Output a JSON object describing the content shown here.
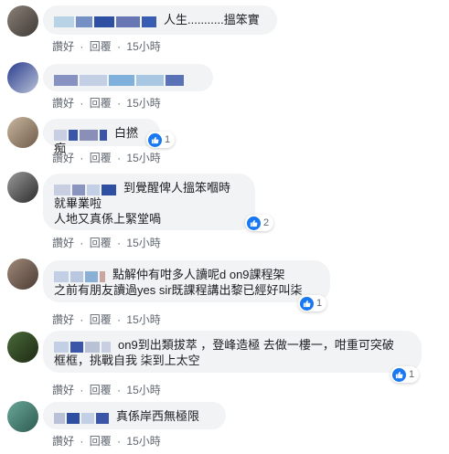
{
  "action_labels": {
    "like": "讚好",
    "reply": "回覆",
    "sep": "·"
  },
  "comments": [
    {
      "text": "人生...........搵笨實",
      "time": "15小時"
    },
    {
      "text": "",
      "time": "15小時"
    },
    {
      "text": "白撚痴",
      "time": "15小時",
      "reactions": "1"
    },
    {
      "text_line1": "到覺醒俾人搵笨嗰時",
      "text_line2": "就畢業啦",
      "text_line3": "人地又真係上緊堂喎",
      "time": "15小時",
      "reactions": "2"
    },
    {
      "text_line1": "點解仲有咁多人讀呢d on9課程架",
      "text_line2": "之前有朋友讀過yes sir既課程講出黎已經好叫柒",
      "time": "15小時",
      "reactions": "1"
    },
    {
      "text_line1": "on9到出類拔萃 ，登峰造極 去做一樓一，咁重可突破",
      "text_line2": "框框，挑戰自我 柒到上太空",
      "time": "15小時",
      "reactions": "1"
    },
    {
      "text": "真係岸西無極限",
      "time": "15小時"
    }
  ],
  "colors": {
    "bubble": "#f2f3f5",
    "meta": "#606770",
    "like": "#1877f2"
  }
}
